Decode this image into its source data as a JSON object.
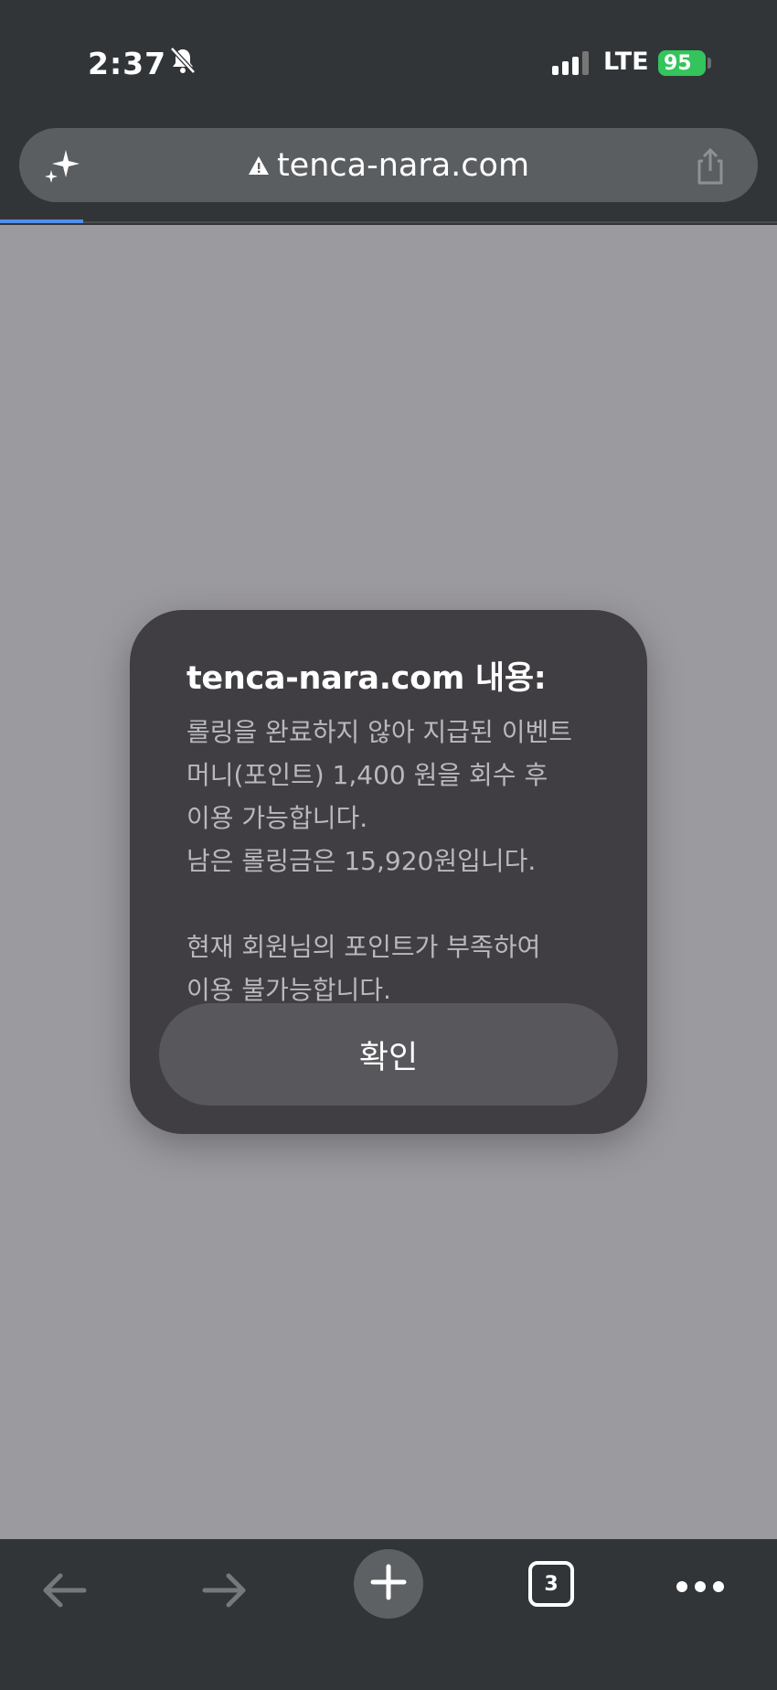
{
  "status_bar": {
    "time": "2:37",
    "network": "LTE",
    "battery": "95"
  },
  "address_bar": {
    "url": "tenca-nara.com"
  },
  "dialog": {
    "title": "tenca-nara.com 내용:",
    "lines": [
      "롤링을 완료하지 않아 지급된 이벤트",
      "머니(포인트) 1,400 원을 회수 후",
      "이용 가능합니다.",
      "남은 롤링금은 15,920원입니다.",
      "",
      "현재 회원님의 포인트가 부족하여",
      "이용 불가능합니다."
    ],
    "ok_label": "확인"
  },
  "toolbar": {
    "tab_count": "3"
  },
  "colors": {
    "battery": "#33c45c",
    "progress": "#4f8fe8",
    "dialog_bg": "#403e43"
  },
  "icons": [
    "bell-slash-icon",
    "signal-icon",
    "sparkle-icon",
    "warning-icon",
    "share-icon",
    "back-arrow-icon",
    "forward-arrow-icon",
    "plus-icon",
    "more-icon"
  ]
}
